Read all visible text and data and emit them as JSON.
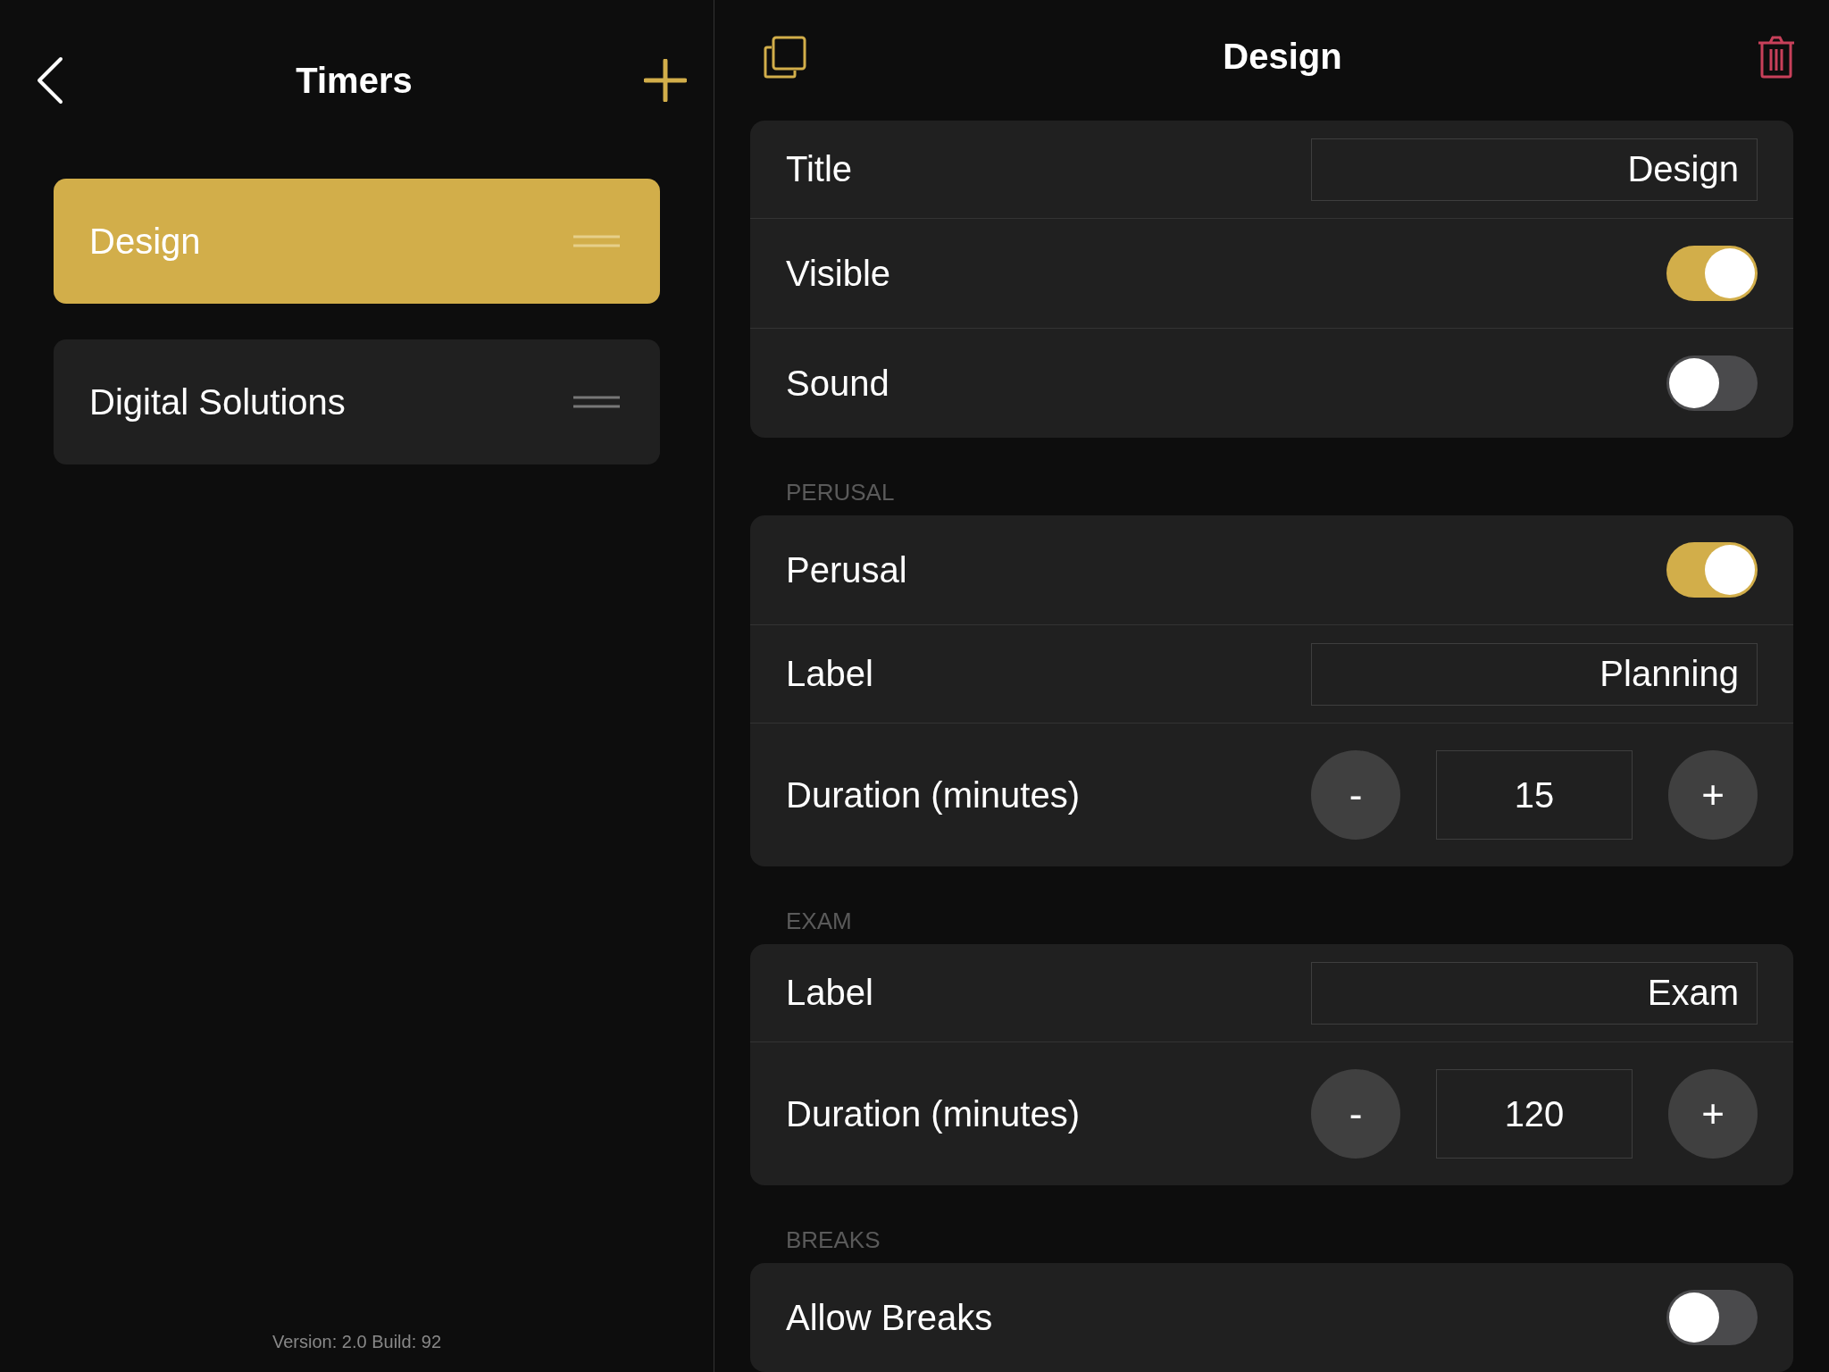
{
  "sidebar": {
    "title": "Timers",
    "items": [
      {
        "label": "Design",
        "selected": true
      },
      {
        "label": "Digital Solutions",
        "selected": false
      }
    ],
    "version": "Version: 2.0 Build: 92"
  },
  "detail": {
    "title": "Design",
    "sections": [
      {
        "rows": [
          {
            "kind": "text",
            "label": "Title",
            "value": "Design"
          },
          {
            "kind": "toggle",
            "label": "Visible",
            "on": true
          },
          {
            "kind": "toggle",
            "label": "Sound",
            "on": false
          }
        ]
      },
      {
        "header": "PERUSAL",
        "rows": [
          {
            "kind": "toggle",
            "label": "Perusal",
            "on": true
          },
          {
            "kind": "text",
            "label": "Label",
            "value": "Planning"
          },
          {
            "kind": "stepper",
            "label": "Duration (minutes)",
            "minus": "-",
            "value": "15",
            "plus": "+"
          }
        ]
      },
      {
        "header": "EXAM",
        "rows": [
          {
            "kind": "text",
            "label": "Label",
            "value": "Exam"
          },
          {
            "kind": "stepper",
            "label": "Duration (minutes)",
            "minus": "-",
            "value": "120",
            "plus": "+"
          }
        ]
      },
      {
        "header": "BREAKS",
        "rows": [
          {
            "kind": "toggle",
            "label": "Allow Breaks",
            "on": false
          }
        ]
      }
    ]
  }
}
